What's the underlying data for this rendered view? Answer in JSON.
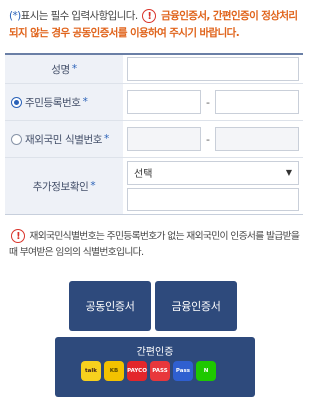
{
  "notice": {
    "required_mark": "(*)",
    "required_text": "표시는 필수 입력사항입니다.",
    "warning_line1": "금융인증서, 간편인증이 정상처리",
    "warning_line2": "되지 않는 경우 공동인증서를 이용하여 주시기 바랍니다.",
    "icon": "exclamation-icon"
  },
  "form": {
    "name_label": "성명",
    "rrn_label": "주민등록번호",
    "foreign_label": "재외국민 식별번호",
    "extra_label": "추가정보확인",
    "required_star": "*",
    "rrn_dash": "-",
    "foreign_dash": "-",
    "select_value": "선택",
    "selected_option": "rrn"
  },
  "info": {
    "text": "재외국민식별번호는 주민등록번호가 없는 재외국민이 인증서를 발급받을 때 부여받은 임의의 식별번호입니다."
  },
  "buttons": {
    "joint_cert": "공동인증서",
    "financial_cert": "금융인증서",
    "simple_auth": "간편인증"
  },
  "simple_icons": [
    {
      "name": "kakao-icon",
      "label": "talk",
      "color": "#f7d11e",
      "text_color": "#3a1d1d"
    },
    {
      "name": "kb-icon",
      "label": "KB",
      "color": "#f2c200",
      "text_color": "#5a4a00"
    },
    {
      "name": "payco-icon",
      "label": "PAYCO",
      "color": "#e3262b",
      "text_color": "#ffffff"
    },
    {
      "name": "pass-icon",
      "label": "PASS",
      "color": "#e8373c",
      "text_color": "#ffffff"
    },
    {
      "name": "samsung-pass-icon",
      "label": "Pass",
      "color": "#2f5fd0",
      "text_color": "#ffffff"
    },
    {
      "name": "naver-icon",
      "label": "N",
      "color": "#1ec800",
      "text_color": "#ffffff"
    }
  ]
}
